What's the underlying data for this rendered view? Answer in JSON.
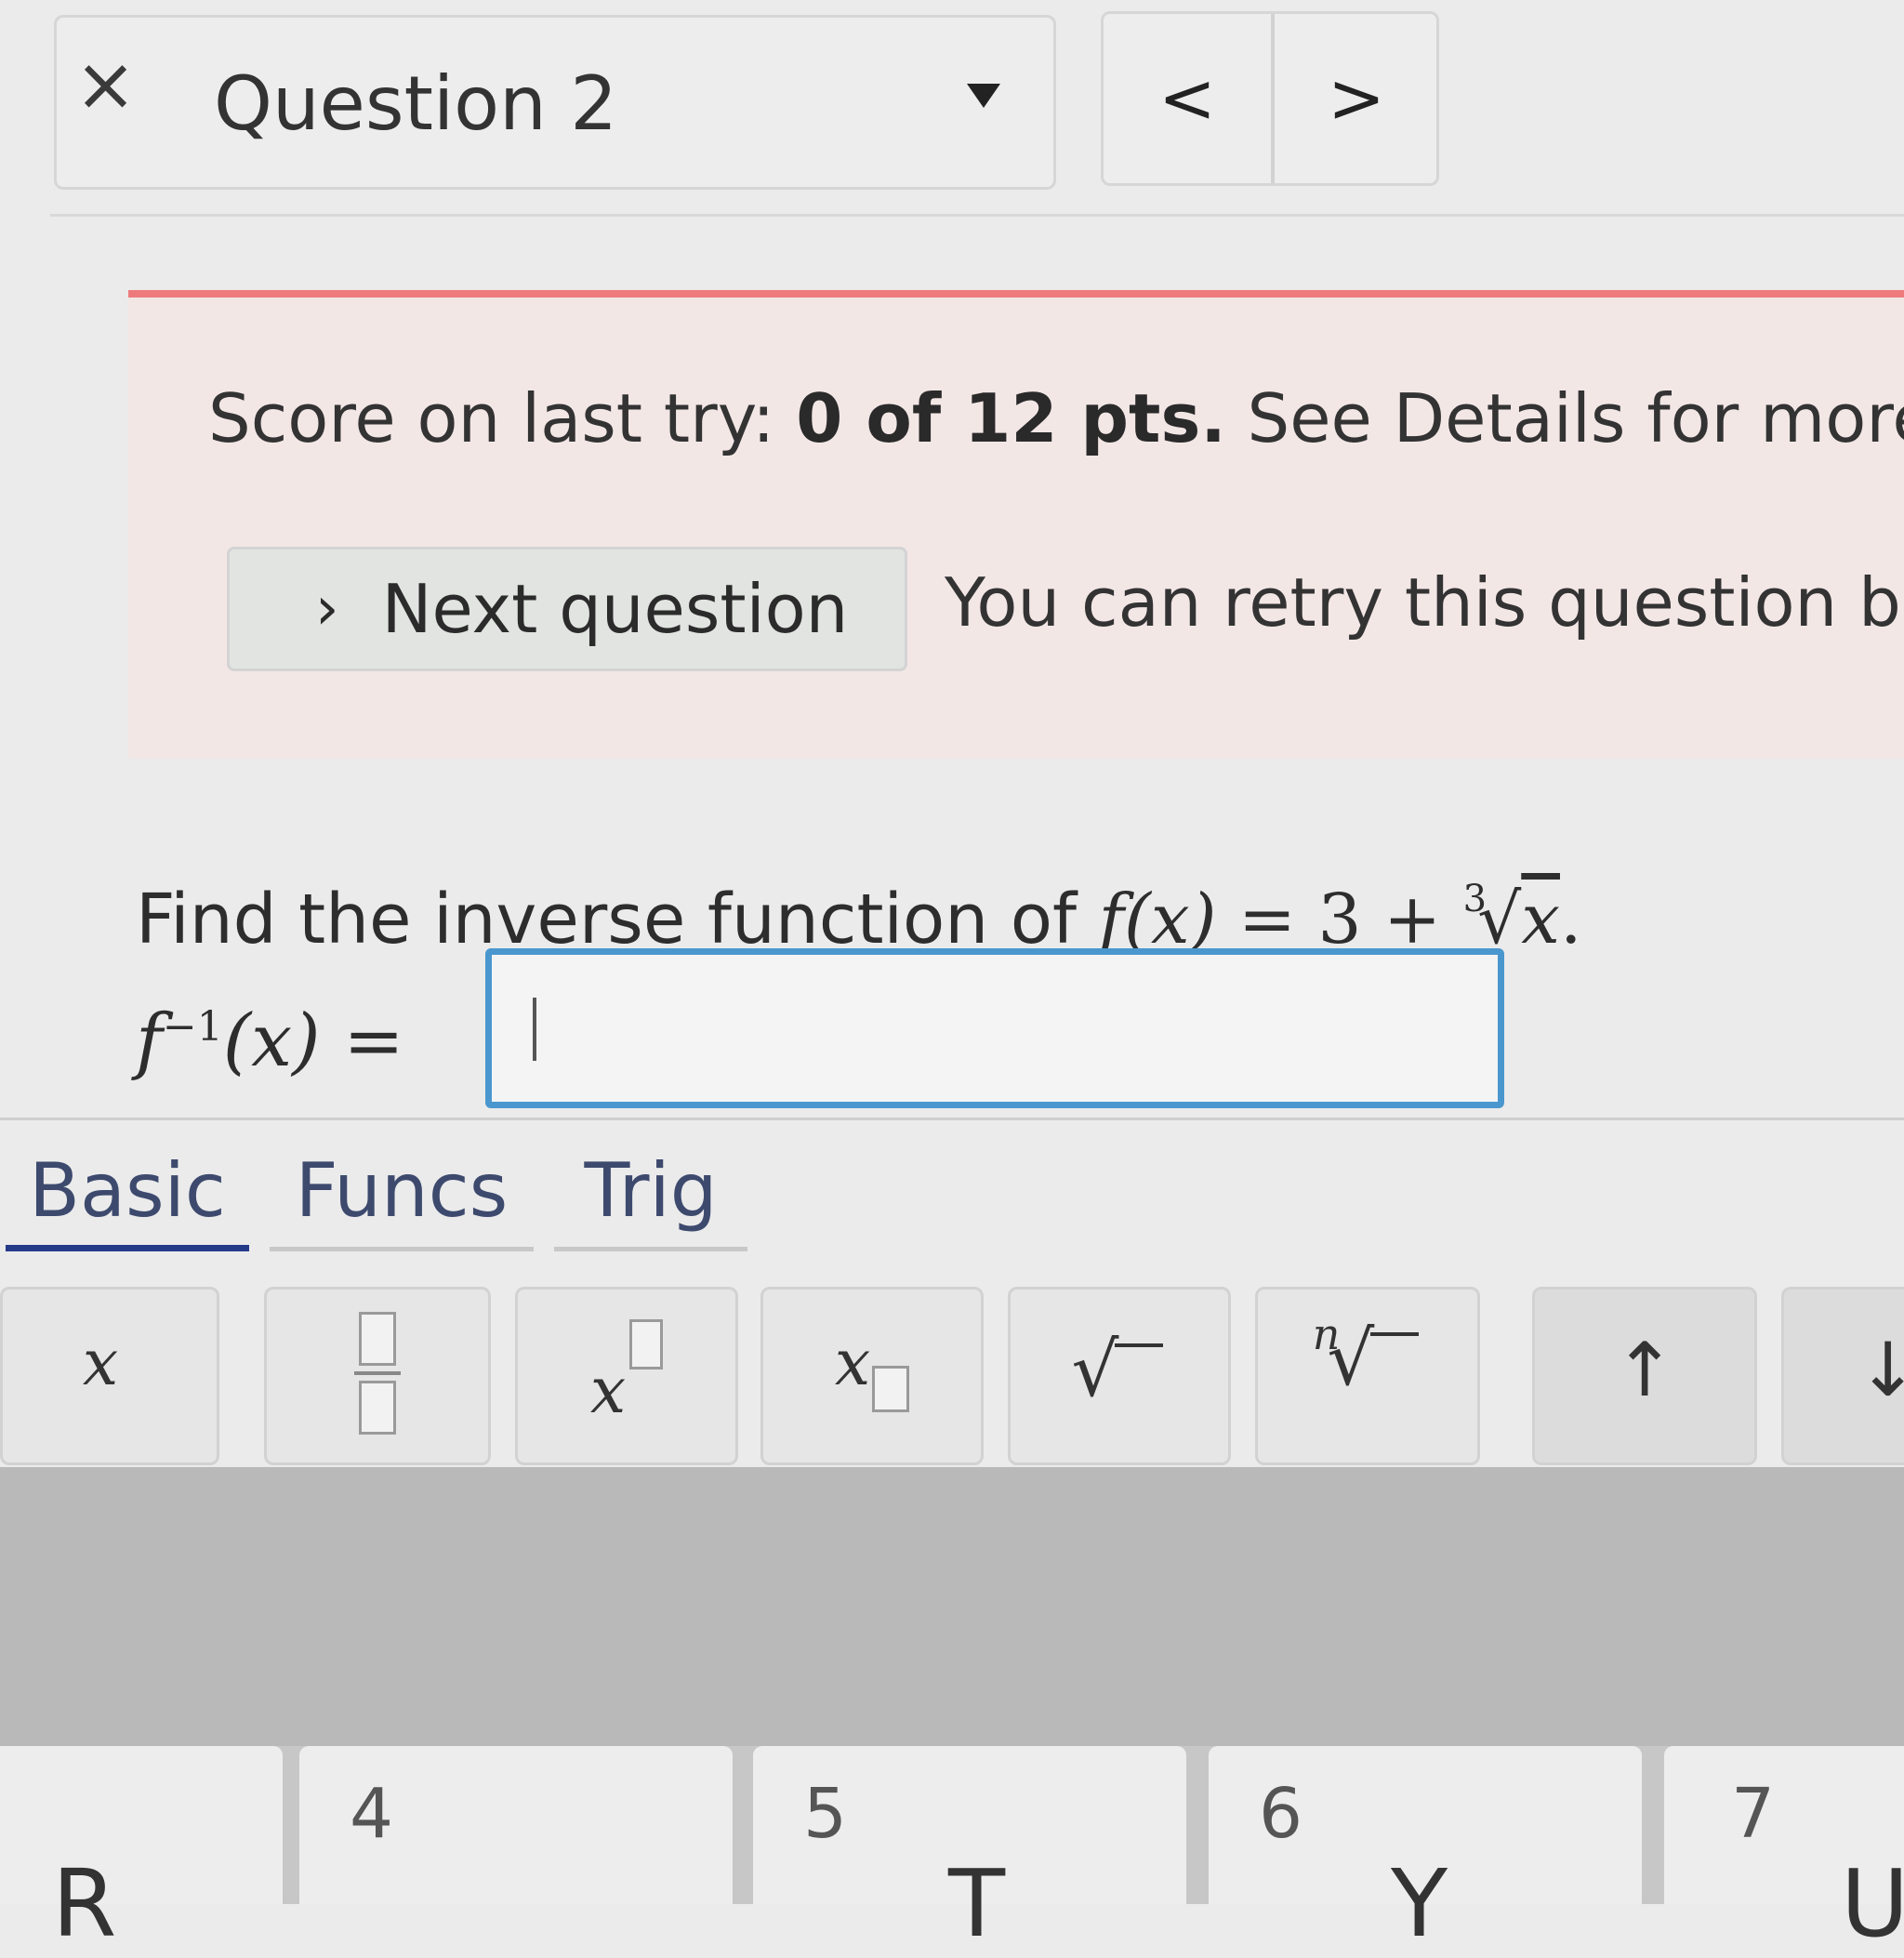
{
  "header": {
    "close_glyph": "×",
    "question_label": "Question 2",
    "prev_glyph": "<",
    "next_glyph": ">"
  },
  "banner": {
    "score_prefix": "Score on last try: ",
    "score_value": "0 of 12 pts.",
    "score_suffix": " See Details for more.",
    "next_button_label": "Next question",
    "retry_text": "You can retry this question be"
  },
  "question": {
    "prompt": "Find the inverse function of ",
    "func_lhs": "f(x)",
    "equals": " = 3 + ",
    "root_index": "3",
    "radicand": "x",
    "period": ".",
    "answer_lhs": "f",
    "answer_sup": "−1",
    "answer_arg": "(x)",
    "answer_eq": " =",
    "answer_value": ""
  },
  "keypad": {
    "tabs": [
      "Basic",
      "Funcs",
      "Trig"
    ],
    "active_tab": "Basic",
    "keys": {
      "x": "x",
      "power_base": "x",
      "subscript_base": "x",
      "sqrt": "√",
      "nthroot_index": "n",
      "nthroot_sign": "√",
      "up": "↑",
      "down": "↓"
    }
  },
  "keyboard": {
    "digits": [
      "4",
      "5",
      "6",
      "7"
    ],
    "letters": [
      "R",
      "T",
      "Y",
      "U"
    ]
  }
}
